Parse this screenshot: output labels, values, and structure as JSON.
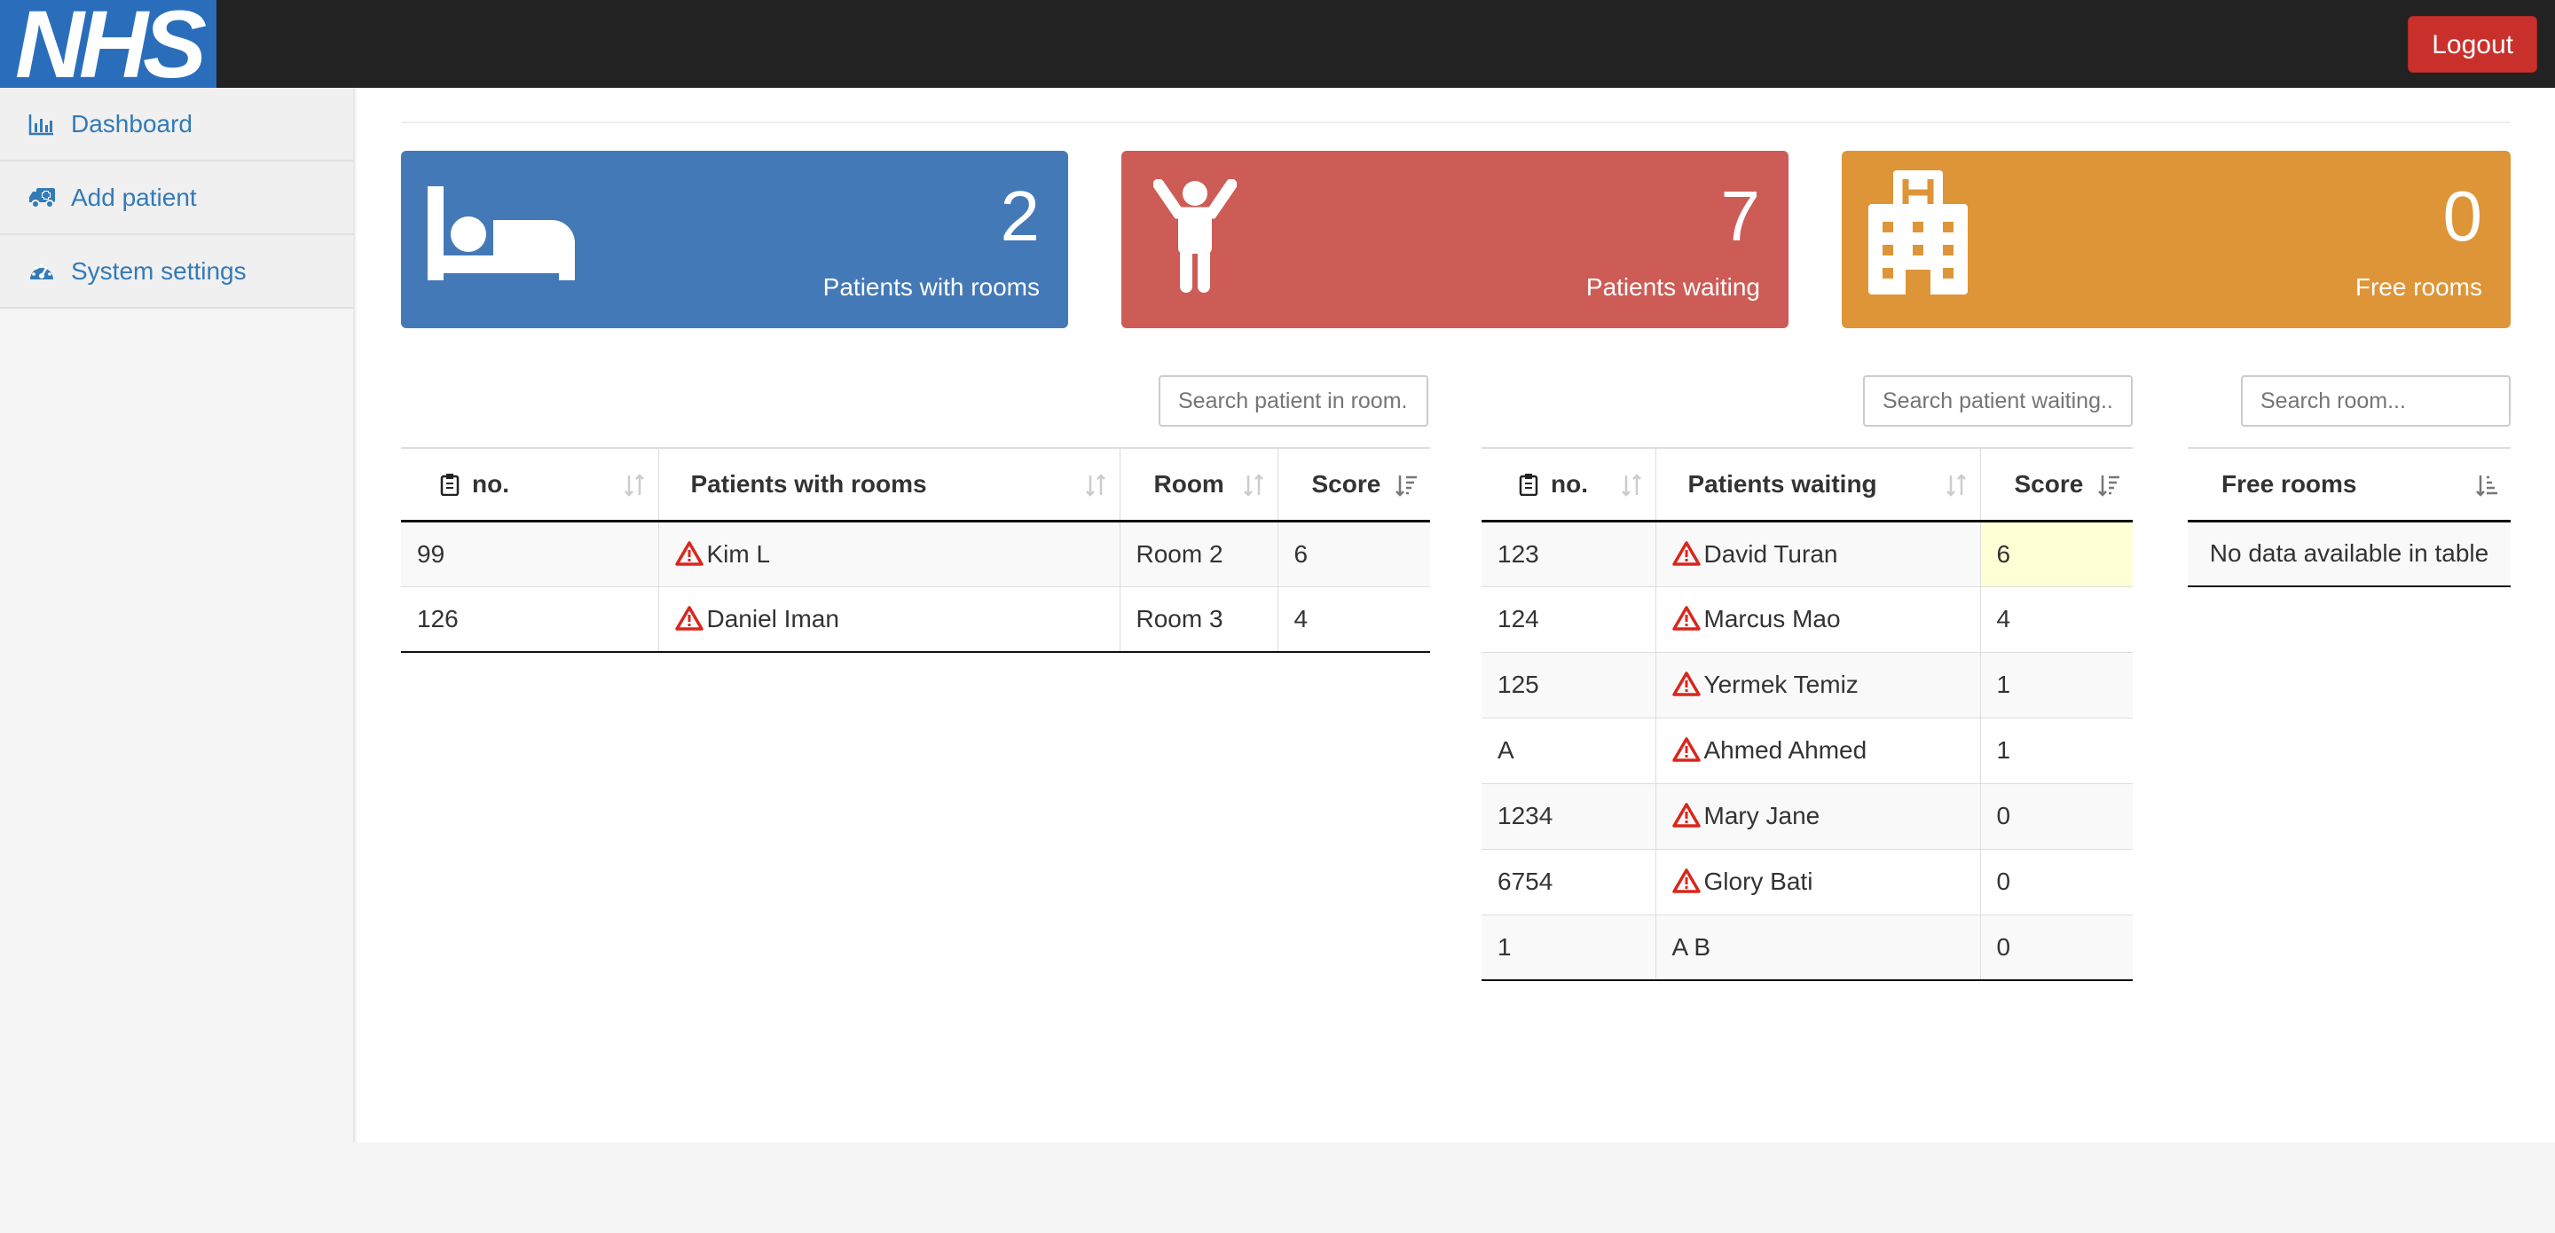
{
  "header": {
    "logo": "NHS",
    "logout_label": "Logout"
  },
  "sidebar": {
    "items": [
      {
        "label": "Dashboard",
        "icon": "bar-chart-icon"
      },
      {
        "label": "Add patient",
        "icon": "ambulance-icon"
      },
      {
        "label": "System settings",
        "icon": "dashboard-gauge-icon"
      }
    ]
  },
  "cards": [
    {
      "value": "2",
      "label": "Patients with rooms",
      "icon": "bed-icon",
      "color": "#4479b7"
    },
    {
      "value": "7",
      "label": "Patients waiting",
      "icon": "child-icon",
      "color": "#cd5c56"
    },
    {
      "value": "0",
      "label": "Free rooms",
      "icon": "hospital-icon",
      "color": "#de9538"
    }
  ],
  "rooms_table": {
    "search_placeholder": "Search patient in room.",
    "headers": [
      "no.",
      "Patients with rooms",
      "Room",
      "Score"
    ],
    "rows": [
      {
        "no": "99",
        "name": "Kim L",
        "room": "Room 2",
        "score": "6"
      },
      {
        "no": "126",
        "name": "Daniel Iman",
        "room": "Room 3",
        "score": "4"
      }
    ]
  },
  "waiting_table": {
    "search_placeholder": "Search patient waiting..",
    "headers": [
      "no.",
      "Patients waiting",
      "Score"
    ],
    "rows": [
      {
        "no": "123",
        "name": "David Turan",
        "score": "6",
        "warn": true
      },
      {
        "no": "124",
        "name": "Marcus Mao",
        "score": "4",
        "warn": true
      },
      {
        "no": "125",
        "name": "Yermek Temiz",
        "score": "1",
        "warn": true
      },
      {
        "no": "A",
        "name": "Ahmed Ahmed",
        "score": "1",
        "warn": true
      },
      {
        "no": "1234",
        "name": "Mary Jane",
        "score": "0",
        "warn": true
      },
      {
        "no": "6754",
        "name": "Glory Bati",
        "score": "0",
        "warn": true
      },
      {
        "no": "1",
        "name": "A B",
        "score": "0",
        "warn": false
      }
    ]
  },
  "free_rooms_table": {
    "search_placeholder": "Search room...",
    "header": "Free rooms",
    "empty_text": "No data available in table"
  }
}
